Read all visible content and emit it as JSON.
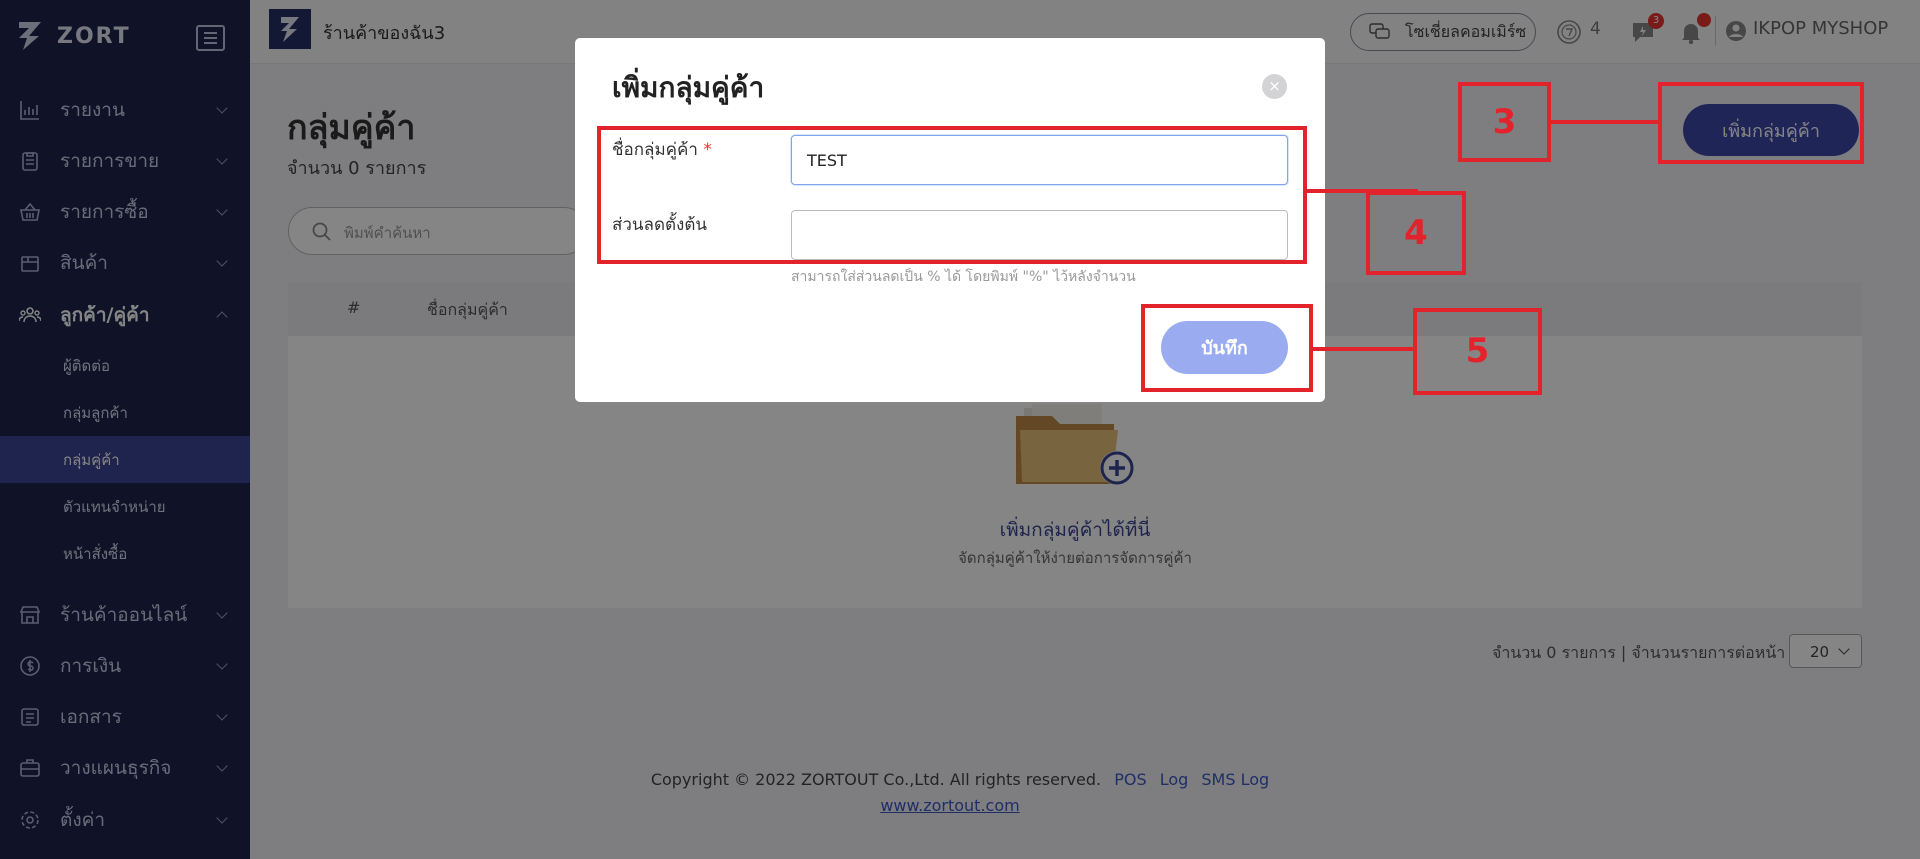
{
  "sidebar": {
    "logo_text": "ZORT",
    "items": [
      {
        "label": "รายงาน",
        "icon": "bar-chart-icon"
      },
      {
        "label": "รายการขาย",
        "icon": "clipboard-icon"
      },
      {
        "label": "รายการซื้อ",
        "icon": "basket-icon"
      },
      {
        "label": "สินค้า",
        "icon": "box-icon"
      },
      {
        "label": "ลูกค้า/คู่ค้า",
        "icon": "users-icon"
      },
      {
        "label": "ร้านค้าออนไลน์",
        "icon": "storefront-icon"
      },
      {
        "label": "การเงิน",
        "icon": "dollar-icon"
      },
      {
        "label": "เอกสาร",
        "icon": "document-icon"
      },
      {
        "label": "วางแผนธุรกิจ",
        "icon": "briefcase-icon"
      },
      {
        "label": "ตั้งค่า",
        "icon": "gear-icon"
      }
    ],
    "sub_items": [
      "ผู้ติดต่อ",
      "กลุ่มลูกค้า",
      "กลุ่มคู่ค้า",
      "ตัวแทนจำหน่าย",
      "หน้าสั่งซื้อ"
    ]
  },
  "topbar": {
    "shop_name": "ร้านค้าของฉัน3",
    "social_label": "โซเชี่ยลคอมเมิร์ซ",
    "coin_count": "4",
    "message_badge": "3",
    "user_name": "IKPOP MYSHOP"
  },
  "main": {
    "title": "กลุ่มคู่ค้า",
    "count_text": "จำนวน 0 รายการ",
    "search_placeholder": "พิมพ์คำค้นหา",
    "add_button": "เพิ่มกลุ่มคู่ค้า",
    "table_headers": [
      "#",
      "ชื่อกลุ่มคู่ค้า"
    ],
    "empty_title": "เพิ่มกลุ่มคู่ค้าได้ที่นี่",
    "empty_subtitle": "จัดกลุ่มคู่ค้าให้ง่ายต่อการจัดการคู่ค้า",
    "pager_text": "จำนวน 0 รายการ | จำนวนรายการต่อหน้า",
    "page_size": "20"
  },
  "footer": {
    "copyright": "Copyright © 2022 ZORTOUT Co.,Ltd. All rights reserved.",
    "links": [
      "POS",
      "Log",
      "SMS Log"
    ],
    "url": "www.zortout.com"
  },
  "modal": {
    "title": "เพิ่มกลุ่มคู่ค้า",
    "close": "×",
    "name_label": "ชื่อกลุ่มคู่ค้า",
    "required_mark": "*",
    "name_value": "TEST",
    "discount_label": "ส่วนลดตั้งต้น",
    "discount_value": "",
    "discount_hint": "สามารถใส่ส่วนลดเป็น % ได้ โดยพิมพ์ \"%\" ไว้หลังจำนวน",
    "save_button": "บันทึก"
  },
  "annotations": [
    "3",
    "4",
    "5"
  ],
  "colors": {
    "sidebar_bg": "#20264e",
    "sidebar_selected": "#3a4694",
    "primary": "#3d4aa8",
    "save_disabled": "#9aabf0",
    "annotation_red": "#e3232c"
  }
}
